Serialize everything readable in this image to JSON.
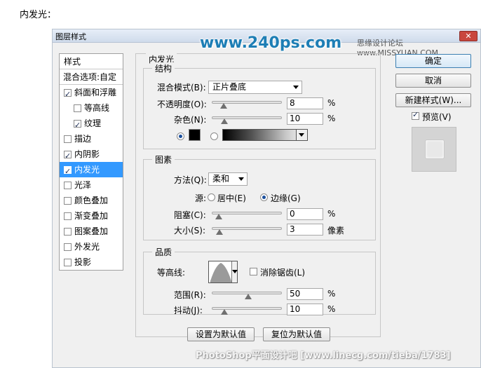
{
  "page_heading": "内发光：",
  "dialog": {
    "title": "图层样式",
    "close_glyph": "✕"
  },
  "watermarks": {
    "site_top": "www.240ps.com",
    "forum_top_right": "思缘设计论坛 www.MISSYUAN.COM",
    "bottom": "PhotoShop平面设计吧 [www.linecg.com/tieba/1783]"
  },
  "styles_list": {
    "header": "样式",
    "blend_options": "混合选项:自定",
    "items": [
      {
        "label": "斜面和浮雕",
        "checked": true,
        "sub": false,
        "selected": false
      },
      {
        "label": "等高线",
        "checked": false,
        "sub": true,
        "selected": false
      },
      {
        "label": "纹理",
        "checked": true,
        "sub": true,
        "selected": false
      },
      {
        "label": "描边",
        "checked": false,
        "sub": false,
        "selected": false
      },
      {
        "label": "内阴影",
        "checked": true,
        "sub": false,
        "selected": false
      },
      {
        "label": "内发光",
        "checked": true,
        "sub": false,
        "selected": true
      },
      {
        "label": "光泽",
        "checked": false,
        "sub": false,
        "selected": false
      },
      {
        "label": "颜色叠加",
        "checked": false,
        "sub": false,
        "selected": false
      },
      {
        "label": "渐变叠加",
        "checked": false,
        "sub": false,
        "selected": false
      },
      {
        "label": "图案叠加",
        "checked": false,
        "sub": false,
        "selected": false
      },
      {
        "label": "外发光",
        "checked": false,
        "sub": false,
        "selected": false
      },
      {
        "label": "投影",
        "checked": false,
        "sub": false,
        "selected": false
      }
    ]
  },
  "panel": {
    "title": "内发光",
    "structure": {
      "title": "结构",
      "blend_mode_label": "混合模式(B):",
      "blend_mode_value": "正片叠底",
      "opacity_label": "不透明度(O):",
      "opacity_value": "8",
      "opacity_unit": "%",
      "opacity_fraction": 0.08,
      "noise_label": "杂色(N):",
      "noise_value": "10",
      "noise_unit": "%",
      "noise_fraction": 0.1,
      "color_swatch": "#000000",
      "color_selected": true
    },
    "elements": {
      "title": "图素",
      "method_label": "方法(Q):",
      "method_value": "柔和",
      "source_label": "源:",
      "source_center": "居中(E)",
      "source_edge": "边缘(G)",
      "choke_label": "阻塞(C):",
      "choke_value": "0",
      "choke_unit": "%",
      "choke_fraction": 0.0,
      "size_label": "大小(S):",
      "size_value": "3",
      "size_unit": "像素",
      "size_fraction": 0.012
    },
    "quality": {
      "title": "品质",
      "contour_label": "等高线:",
      "antialias_label": "消除锯齿(L)",
      "range_label": "范围(R):",
      "range_value": "50",
      "range_unit": "%",
      "range_fraction": 0.5,
      "jitter_label": "抖动(J):",
      "jitter_value": "10",
      "jitter_unit": "%",
      "jitter_fraction": 0.1
    },
    "set_default": "设置为默认值",
    "reset_default": "复位为默认值"
  },
  "buttons": {
    "ok": "确定",
    "cancel": "取消",
    "new_style": "新建样式(W)...",
    "preview_label": "预览(V)",
    "preview_checked": true
  }
}
